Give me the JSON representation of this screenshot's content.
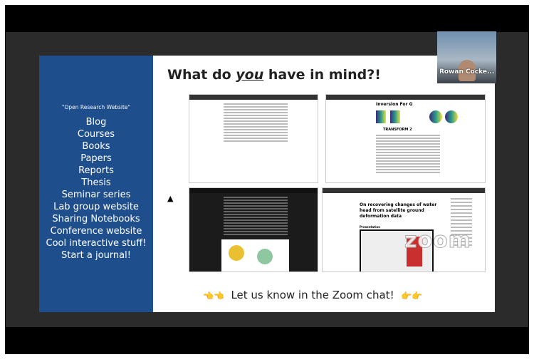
{
  "participant": {
    "name": "Rowan Cocke..."
  },
  "slide": {
    "title_pre": "What do ",
    "title_em": "you",
    "title_post": " have in mind?!",
    "left_panel": {
      "subtitle": "\"Open Research Website\"",
      "items": [
        "Blog",
        "Courses",
        "Books",
        "Papers",
        "Reports",
        "Thesis",
        "Seminar series",
        "Lab group website",
        "Sharing Notebooks",
        "Conference website",
        "Cool interactive stuff!",
        "Start a journal!"
      ]
    },
    "thumbnails": {
      "top_right_heading": "Inversion For G",
      "top_right_sub": "TRANSFORM 2",
      "bottom_right_heading": "On recovering changes of water head from satellite ground deformation data",
      "bottom_right_section": "Presentation"
    },
    "footer": "Let us know in the Zoom chat!"
  },
  "watermark": "zoom",
  "colors": {
    "panel": "#1f4e8c",
    "hand": "#f0b030"
  }
}
